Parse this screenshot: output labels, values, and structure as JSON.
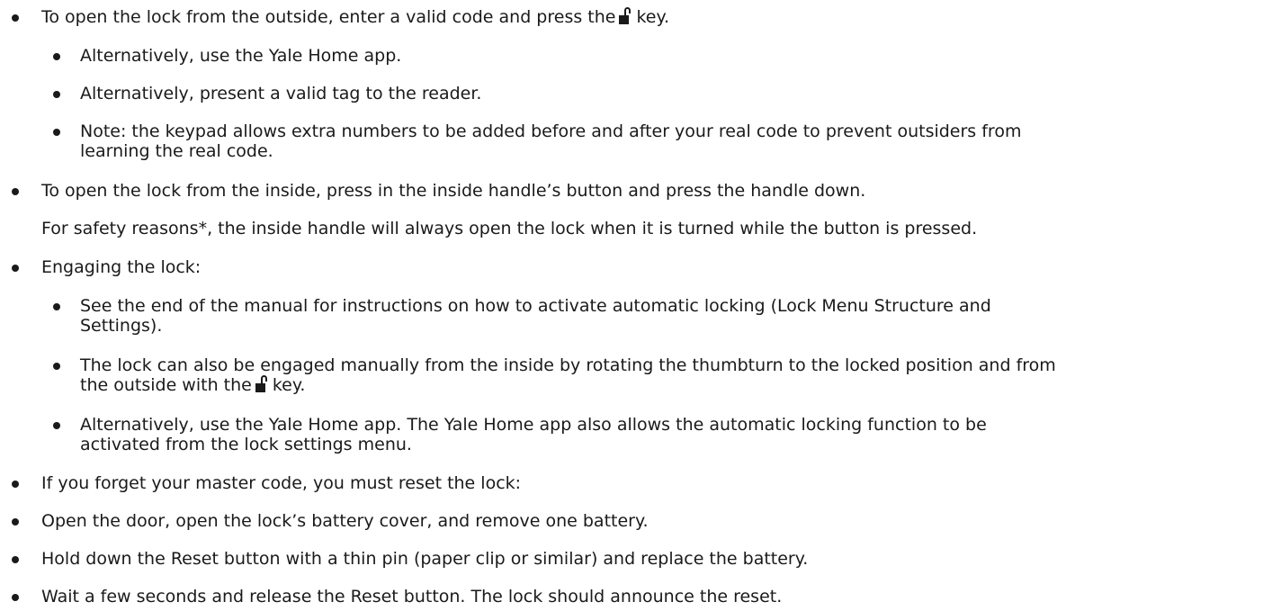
{
  "items": [
    {
      "level": 1,
      "bullet": true,
      "text_before": "To open the lock from the outside, enter a valid code and press the",
      "icon": "unlock-icon",
      "text_after": "key."
    },
    {
      "level": 2,
      "bullet": true,
      "text": "Alternatively, use the Yale Home app."
    },
    {
      "level": 2,
      "bullet": true,
      "text": "Alternatively, present a valid tag to the reader."
    },
    {
      "level": 2,
      "bullet": true,
      "line1": "Note: the keypad allows extra numbers to be added before and after your real code to prevent outsiders from",
      "line2": "learning the real code."
    },
    {
      "level": 1,
      "bullet": true,
      "text": "To open the lock from the inside, press in the inside handle’s button and press the handle down."
    },
    {
      "level": 1,
      "bullet": false,
      "text": "For safety reasons*, the inside handle will always open the lock when it is turned while the button is pressed."
    },
    {
      "level": 1,
      "bullet": true,
      "text": "Engaging the lock:"
    },
    {
      "level": 2,
      "bullet": true,
      "line1": "See the end of the manual for instructions on how to activate automatic locking (Lock Menu Structure and",
      "line2": "Settings)."
    },
    {
      "level": 2,
      "bullet": true,
      "line1": "The lock can also be engaged manually from the inside by rotating the thumbturn to the locked position and from",
      "line2_before": "the outside with the",
      "icon": "unlock-icon",
      "line2_after": "key."
    },
    {
      "level": 2,
      "bullet": true,
      "line1": "Alternatively, use the Yale Home app. The Yale Home app also allows the automatic locking function to be",
      "line2": "activated from the lock settings menu."
    },
    {
      "level": 1,
      "bullet": true,
      "text": "If you forget your master code, you must reset the lock:"
    },
    {
      "level": 1,
      "bullet": true,
      "text": "Open the door, open the lock’s battery cover, and remove one battery."
    },
    {
      "level": 1,
      "bullet": true,
      "text": "Hold down the Reset button with a thin pin (paper clip or similar) and replace the battery."
    },
    {
      "level": 1,
      "bullet": true,
      "text": "Wait a few seconds and release the Reset button. The lock should announce the reset."
    }
  ]
}
